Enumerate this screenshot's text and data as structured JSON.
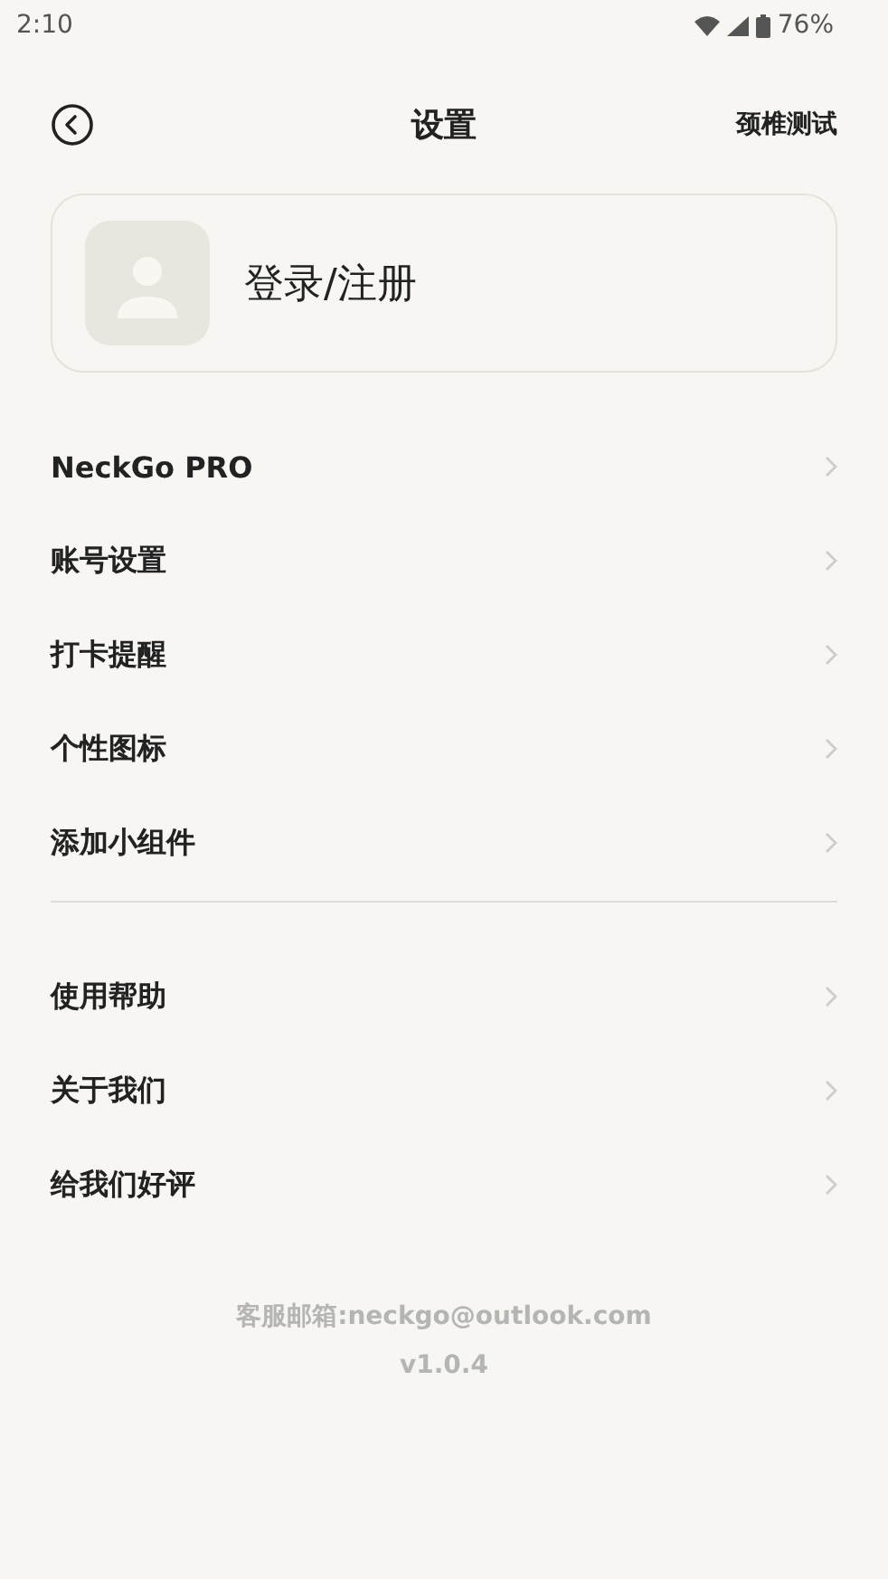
{
  "status_bar": {
    "time": "2:10",
    "battery": "76%"
  },
  "header": {
    "title": "设置",
    "action": "颈椎测试"
  },
  "account": {
    "label": "登录/注册"
  },
  "menu_groups": [
    {
      "items": [
        "NeckGo PRO",
        "账号设置",
        "打卡提醒",
        "个性图标",
        "添加小组件"
      ]
    },
    {
      "items": [
        "使用帮助",
        "关于我们",
        "给我们好评"
      ]
    }
  ],
  "footer": {
    "contact": "客服邮箱:neckgo@outlook.com",
    "version": "v1.0.4"
  }
}
